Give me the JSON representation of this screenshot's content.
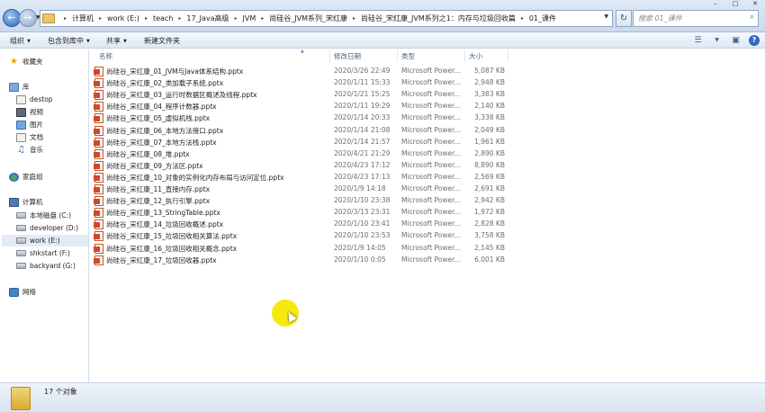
{
  "address_bar": {
    "breadcrumbs": [
      "计算机",
      "work (E:)",
      "teach",
      "17_Java高级",
      "JVM",
      "尚硅谷_JVM系列_宋红康",
      "尚硅谷_宋红康_JVM系列之1：内存与垃圾回收篇",
      "01_课件"
    ],
    "search_placeholder": "搜索 01_课件"
  },
  "toolbar": {
    "organize": "组织",
    "include_in_library": "包含到库中",
    "share": "共享",
    "new_folder": "新建文件夹"
  },
  "nav": {
    "favorites": "收藏夹",
    "libraries": "库",
    "lib_items": [
      "destop",
      "视频",
      "图片",
      "文档",
      "音乐"
    ],
    "homegroup": "家庭组",
    "computer": "计算机",
    "drives": [
      "本地磁盘 (C:)",
      "developer (D:)",
      "work (E:)",
      "shkstart (F:)",
      "backyard (G:)"
    ],
    "network": "网络"
  },
  "columns": {
    "name": "名称",
    "modified": "修改日期",
    "type": "类型",
    "size": "大小"
  },
  "files": [
    {
      "name": "尚硅谷_宋红康_01_JVM与Java体系结构.pptx",
      "date": "2020/3/26 22:49",
      "type": "Microsoft Power...",
      "size": "5,087 KB"
    },
    {
      "name": "尚硅谷_宋红康_02_类加载子系统.pptx",
      "date": "2020/1/11 15:33",
      "type": "Microsoft Power...",
      "size": "2,948 KB"
    },
    {
      "name": "尚硅谷_宋红康_03_运行时数据区概述及线程.pptx",
      "date": "2020/1/21 15:25",
      "type": "Microsoft Power...",
      "size": "3,383 KB"
    },
    {
      "name": "尚硅谷_宋红康_04_程序计数器.pptx",
      "date": "2020/1/11 19:29",
      "type": "Microsoft Power...",
      "size": "2,140 KB"
    },
    {
      "name": "尚硅谷_宋红康_05_虚拟机栈.pptx",
      "date": "2020/1/14 20:33",
      "type": "Microsoft Power...",
      "size": "3,338 KB"
    },
    {
      "name": "尚硅谷_宋红康_06_本地方法接口.pptx",
      "date": "2020/1/14 21:08",
      "type": "Microsoft Power...",
      "size": "2,049 KB"
    },
    {
      "name": "尚硅谷_宋红康_07_本地方法栈.pptx",
      "date": "2020/1/14 21:57",
      "type": "Microsoft Power...",
      "size": "1,961 KB"
    },
    {
      "name": "尚硅谷_宋红康_08_堆.pptx",
      "date": "2020/4/21 21:29",
      "type": "Microsoft Power...",
      "size": "2,890 KB"
    },
    {
      "name": "尚硅谷_宋红康_09_方法区.pptx",
      "date": "2020/4/23 17:12",
      "type": "Microsoft Power...",
      "size": "8,890 KB"
    },
    {
      "name": "尚硅谷_宋红康_10_对象的实例化内存布局与访问定位.pptx",
      "date": "2020/4/23 17:13",
      "type": "Microsoft Power...",
      "size": "2,569 KB"
    },
    {
      "name": "尚硅谷_宋红康_11_直接内存.pptx",
      "date": "2020/1/9 14:18",
      "type": "Microsoft Power...",
      "size": "2,691 KB"
    },
    {
      "name": "尚硅谷_宋红康_12_执行引擎.pptx",
      "date": "2020/1/10 23:38",
      "type": "Microsoft Power...",
      "size": "2,942 KB"
    },
    {
      "name": "尚硅谷_宋红康_13_StringTable.pptx",
      "date": "2020/3/13 23:31",
      "type": "Microsoft Power...",
      "size": "1,972 KB"
    },
    {
      "name": "尚硅谷_宋红康_14_垃圾回收概述.pptx",
      "date": "2020/1/10 23:41",
      "type": "Microsoft Power...",
      "size": "2,828 KB"
    },
    {
      "name": "尚硅谷_宋红康_15_垃圾回收相关算法.pptx",
      "date": "2020/1/10 23:53",
      "type": "Microsoft Power...",
      "size": "3,758 KB"
    },
    {
      "name": "尚硅谷_宋红康_16_垃圾回收相关概念.pptx",
      "date": "2020/1/9 14:05",
      "type": "Microsoft Power...",
      "size": "2,145 KB"
    },
    {
      "name": "尚硅谷_宋红康_17_垃圾回收器.pptx",
      "date": "2020/1/10 0:05",
      "type": "Microsoft Power...",
      "size": "6,001 KB"
    }
  ],
  "status": {
    "item_count": "17 个对象"
  }
}
